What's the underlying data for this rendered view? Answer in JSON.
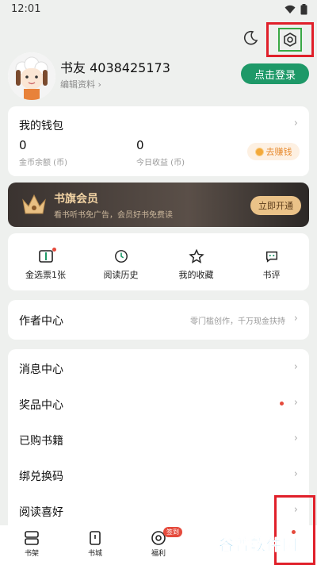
{
  "status_bar": {
    "time": "12:01"
  },
  "profile": {
    "name": "书友 4038425173",
    "edit_label": "编辑资料",
    "login_button": "点击登录"
  },
  "wallet": {
    "title": "我的钱包",
    "coin_balance": "0",
    "coin_caption": "金币余额 (币)",
    "today_earnings": "0",
    "today_caption": "今日收益 (币)",
    "earn_button": "去赚钱"
  },
  "vip": {
    "title": "书旗会员",
    "subtitle": "看书听书免广告，会员好书免费读",
    "button": "立即开通"
  },
  "quick_actions": [
    {
      "label": "金选票1张",
      "icon": "ticket-icon"
    },
    {
      "label": "阅读历史",
      "icon": "clock-icon"
    },
    {
      "label": "我的收藏",
      "icon": "star-icon"
    },
    {
      "label": "书评",
      "icon": "comment-icon"
    }
  ],
  "author_center": {
    "title": "作者中心",
    "hint": "零门槛创作，千万现金扶持"
  },
  "menu": [
    {
      "label": "消息中心"
    },
    {
      "label": "奖品中心"
    },
    {
      "label": "已购书籍"
    },
    {
      "label": "绑兑换码"
    },
    {
      "label": "阅读喜好"
    }
  ],
  "tabs": [
    {
      "label": "书架",
      "icon": "bookshelf-icon"
    },
    {
      "label": "书城",
      "icon": "bookstore-icon"
    },
    {
      "label": "福利",
      "icon": "welfare-icon",
      "badge": "签到"
    },
    {
      "label": "",
      "icon": "category-icon"
    },
    {
      "label": "",
      "icon": "profile-icon"
    }
  ],
  "watermark": "谷普软件园",
  "colors": {
    "primary": "#1e9968",
    "accent_orange": "#e78a2e",
    "vip_gold": "#eac288",
    "highlight_red": "#e0202a",
    "highlight_green": "#3aa845"
  }
}
